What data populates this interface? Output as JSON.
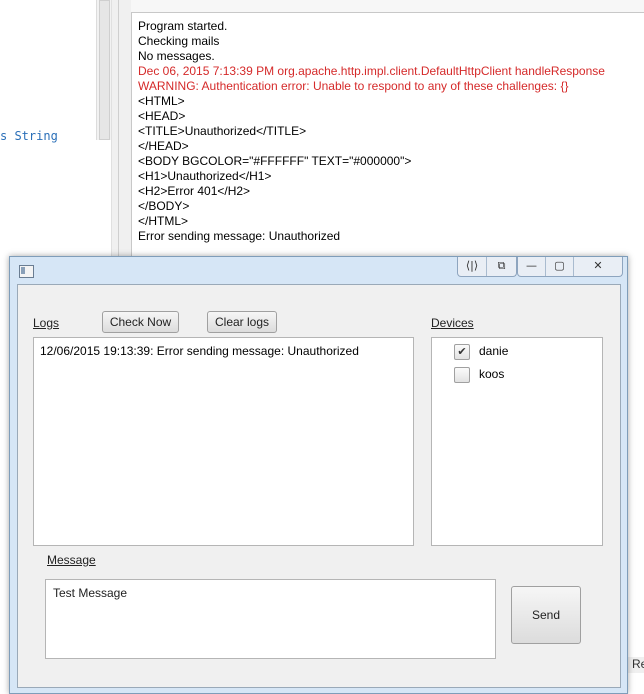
{
  "ide": {
    "code_fragment": "s String",
    "status_right": "l Re"
  },
  "console": {
    "lines": [
      {
        "text": "Program started.",
        "error": false
      },
      {
        "text": "Checking mails",
        "error": false
      },
      {
        "text": "No messages.",
        "error": false
      },
      {
        "text": "Dec 06, 2015 7:13:39 PM org.apache.http.impl.client.DefaultHttpClient handleResponse",
        "error": true
      },
      {
        "text": "WARNING: Authentication error: Unable to respond to any of these challenges: {}",
        "error": true
      },
      {
        "text": "<HTML>",
        "error": false
      },
      {
        "text": "<HEAD>",
        "error": false
      },
      {
        "text": "<TITLE>Unauthorized</TITLE>",
        "error": false
      },
      {
        "text": "</HEAD>",
        "error": false
      },
      {
        "text": "<BODY BGCOLOR=\"#FFFFFF\" TEXT=\"#000000\">",
        "error": false
      },
      {
        "text": "<H1>Unauthorized</H1>",
        "error": false
      },
      {
        "text": "<H2>Error 401</H2>",
        "error": false
      },
      {
        "text": "</BODY>",
        "error": false
      },
      {
        "text": "</HTML>",
        "error": false
      },
      {
        "text": "Error sending message: Unauthorized",
        "error": false
      }
    ]
  },
  "window": {
    "title_buttons": {
      "aero_peek": "⟨|⟩",
      "pin": "⧉",
      "minimize": "—",
      "maximize": "▢",
      "close": "✕"
    }
  },
  "logs": {
    "label": "Logs",
    "check_now_label": "Check Now",
    "clear_logs_label": "Clear logs",
    "entries": [
      "12/06/2015 19:13:39: Error sending message: Unauthorized"
    ]
  },
  "devices": {
    "label": "Devices",
    "items": [
      {
        "name": "danie",
        "checked": true
      },
      {
        "name": "koos",
        "checked": false
      }
    ]
  },
  "message": {
    "label": "Message",
    "value": "Test Message",
    "send_label": "Send"
  },
  "colors": {
    "error_text": "#d52a2a",
    "code_keyword": "#2a6fb8"
  }
}
